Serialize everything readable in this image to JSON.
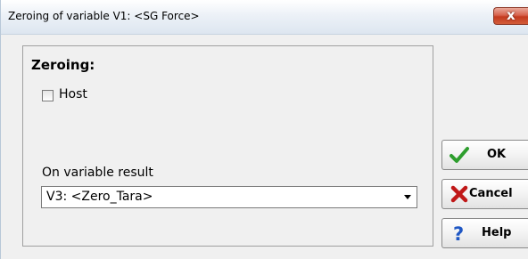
{
  "window": {
    "title": "Zeroing of variable V1: <SG Force>",
    "close_label": "x"
  },
  "group": {
    "title": "Zeroing:",
    "host_checkbox": {
      "label": "Host",
      "checked": false
    },
    "result_label": "On variable result",
    "result_select": {
      "value": "V3: <Zero_Tara>"
    }
  },
  "buttons": {
    "ok": "OK",
    "cancel": "Cancel",
    "help": "Help"
  },
  "icons": {
    "ok": "checkmark-icon",
    "cancel": "x-icon",
    "help": "question-icon",
    "ok_color": "#2e9e2e",
    "cancel_color": "#c01818",
    "help_color": "#1f57c4"
  }
}
